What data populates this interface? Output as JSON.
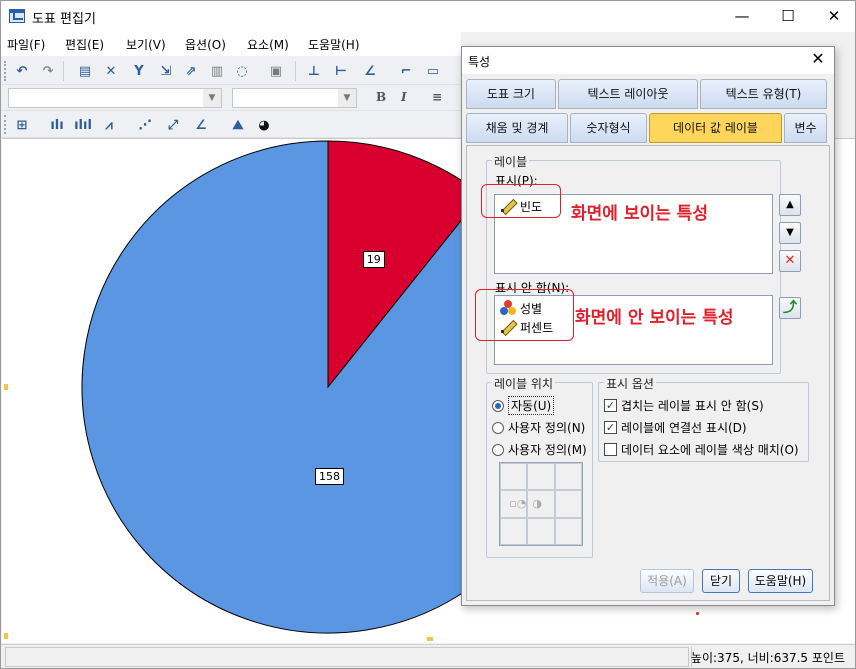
{
  "window": {
    "title": "도표 편집기",
    "minimize": "—",
    "maximize": "☐",
    "close": "✕"
  },
  "menu": [
    "파일(F)",
    "편집(E)",
    "보기(V)",
    "옵션(O)",
    "요소(M)",
    "도움말(H)"
  ],
  "toolbar1_icons": [
    "undo-icon",
    "redo-icon",
    "properties-icon",
    "cross-icon",
    "filter-icon",
    "transpose-icon",
    "scale-icon",
    "bar-chart-icon",
    "lasso-icon",
    "text-frame-icon",
    "axis-x-icon",
    "axis-y-icon",
    "scale-line-icon",
    "frame-icon",
    "frame-alt-icon"
  ],
  "toolbar2": {
    "font_name": "",
    "font_size": "",
    "bold": "B",
    "italic": "I",
    "align": "≡"
  },
  "toolbar3_icons": [
    "data-label-mode-icon",
    "bar-icon",
    "bar-group-icon",
    "line-icon",
    "scatter-icon",
    "scatter-fit-icon",
    "area-icon",
    "mountain-icon",
    "pie-icon"
  ],
  "chart_data": {
    "type": "pie",
    "categories": [
      "",
      ""
    ],
    "values": [
      158,
      19
    ],
    "data_labels": [
      "158",
      "19"
    ],
    "colors": [
      "#5b96e2",
      "#d9002f"
    ]
  },
  "statusbar": {
    "text": "높이:375, 너비:637.5 포인트"
  },
  "dialog": {
    "title": "특성",
    "close": "✕",
    "tabs_row1": [
      "도표 크기",
      "텍스트 레이아웃",
      "텍스트 유형(T)"
    ],
    "tabs_row2": [
      "채움 및 경계",
      "숫자형식",
      "데이터 값 레이블",
      "변수"
    ],
    "active_tab": "데이터 값 레이블",
    "labels_group": "레이블",
    "display_label": "표시(P):",
    "display_items": [
      "빈도"
    ],
    "hidden_label": "표시 안 함(N):",
    "hidden_items": [
      "성별",
      "퍼센트"
    ],
    "side_buttons": {
      "up": "▲",
      "down": "▼",
      "delete": "✕"
    },
    "annotation_shown": "화면에 보이는 특성",
    "annotation_hidden": "화면에 안 보이는 특성",
    "position_group": "레이블 위치",
    "position_options": [
      "자동(U)",
      "사용자 정의(N)",
      "사용자 정의(M)"
    ],
    "display_options_group": "표시 옵션",
    "display_options": [
      {
        "label": "겹치는 레이블 표시 안 함(S)",
        "checked": true
      },
      {
        "label": "레이블에 연결선 표시(D)",
        "checked": true
      },
      {
        "label": "데이터 요소에 레이블 색상 매치(O)",
        "checked": false
      }
    ],
    "buttons": {
      "apply": "적용(A)",
      "close": "닫기",
      "help": "도움말(H)"
    }
  }
}
